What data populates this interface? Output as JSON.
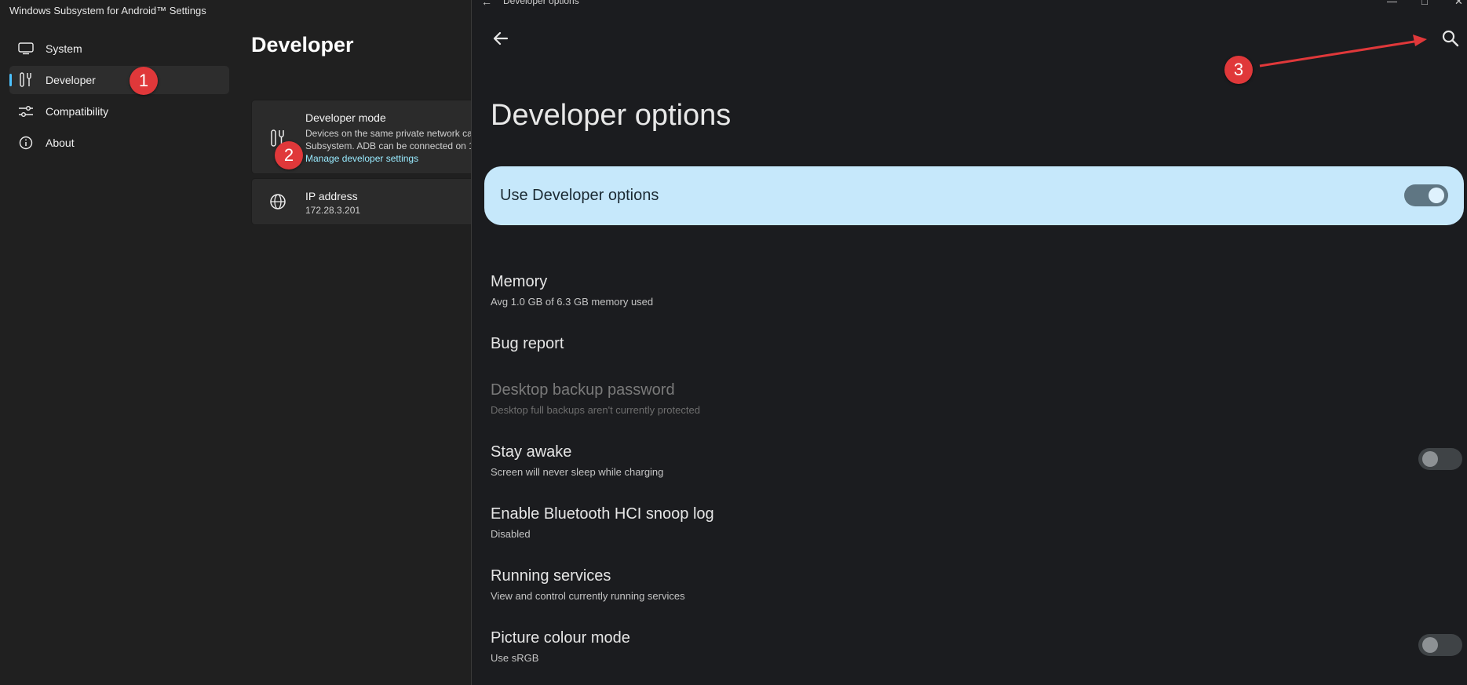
{
  "left_window": {
    "title": "Windows Subsystem for Android™ Settings",
    "nav": [
      {
        "label": "System",
        "icon": "monitor-icon"
      },
      {
        "label": "Developer",
        "icon": "tools-icon",
        "selected": true
      },
      {
        "label": "Compatibility",
        "icon": "sliders-icon"
      },
      {
        "label": "About",
        "icon": "info-icon"
      }
    ],
    "page_title": "Developer",
    "developer_mode": {
      "title": "Developer mode",
      "desc_line1": "Devices on the same private network ca",
      "desc_line2": "Subsystem. ADB can be connected on 1",
      "link": "Manage developer settings"
    },
    "ip_address": {
      "title": "IP address",
      "value": "172.28.3.201"
    }
  },
  "markers": [
    "1",
    "2",
    "3"
  ],
  "android": {
    "window_title": "Developer options",
    "heading": "Developer options",
    "main_switch": {
      "label": "Use Developer options",
      "state": "on"
    },
    "prefs": [
      {
        "title": "Memory",
        "summary": "Avg 1.0 GB of 6.3 GB memory used"
      },
      {
        "title": "Bug report",
        "summary": ""
      },
      {
        "title": "Desktop backup password",
        "summary": "Desktop full backups aren't currently protected",
        "disabled": true
      },
      {
        "title": "Stay awake",
        "summary": "Screen will never sleep while charging",
        "toggle": "off"
      },
      {
        "title": "Enable Bluetooth HCI snoop log",
        "summary": "Disabled"
      },
      {
        "title": "Running services",
        "summary": "View and control currently running services"
      },
      {
        "title": "Picture colour mode",
        "summary": "Use sRGB",
        "toggle": "off"
      }
    ]
  },
  "colors": {
    "accent": "#4cc2ff",
    "link": "#99ebff",
    "marker": "#e0383a",
    "switch_bar": "#c6e8fb"
  }
}
